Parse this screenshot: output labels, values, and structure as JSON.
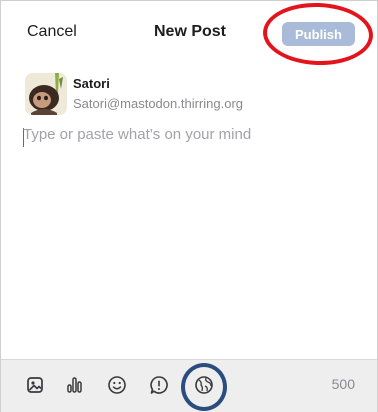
{
  "header": {
    "cancel_label": "Cancel",
    "title": "New Post",
    "publish_label": "Publish"
  },
  "account": {
    "display_name": "Satori",
    "handle": "Satori@mastodon.thirring.org"
  },
  "composer": {
    "placeholder": "Type or paste what’s on your mind",
    "value": ""
  },
  "toolbar": {
    "icons": [
      "image-icon",
      "poll-icon",
      "emoji-icon",
      "content-warning-icon",
      "globe-visibility-icon"
    ],
    "char_count": "500"
  },
  "colors": {
    "publish_disabled": "#a9bbd8",
    "toolbar_bg": "#eeeeef",
    "annotation_red": "#e3141c",
    "annotation_blue": "#2b4c7e"
  }
}
